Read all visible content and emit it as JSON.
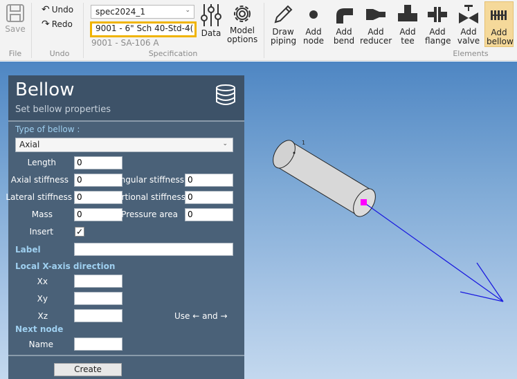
{
  "ribbon": {
    "file": {
      "save_label": "Save",
      "group_label": "File"
    },
    "undo": {
      "undo_label": "Undo",
      "redo_label": "Redo",
      "group_label": "Undo"
    },
    "specification": {
      "spec_value": "spec2024_1",
      "pipe_value": "9001 - 6\" Sch 40-Std-4(",
      "material_text": "9001 - SA-106 A",
      "data_label": "Data",
      "model_options_label": "Model options",
      "group_label": "Specification"
    },
    "elements": {
      "items": [
        {
          "label": "Draw piping",
          "icon": "pencil-icon"
        },
        {
          "label": "Add node",
          "icon": "dot-icon"
        },
        {
          "label": "Add bend",
          "icon": "bend-icon"
        },
        {
          "label": "Add reducer",
          "icon": "reducer-icon"
        },
        {
          "label": "Add tee",
          "icon": "tee-icon"
        },
        {
          "label": "Add flange",
          "icon": "flange-icon"
        },
        {
          "label": "Add valve",
          "icon": "valve-icon"
        },
        {
          "label": "Add bellow",
          "icon": "bellow-icon"
        }
      ],
      "group_label": "Elements"
    }
  },
  "panel": {
    "title": "Bellow",
    "subtitle": "Set bellow properties",
    "type_label": "Type of bellow :",
    "type_value": "Axial",
    "fields": {
      "length": {
        "label": "Length",
        "value": "0"
      },
      "axial_stiffness": {
        "label": "Axial stiffness",
        "value": "0"
      },
      "angular_stiffness": {
        "label": "Angular stiffness",
        "value": "0"
      },
      "lateral_stiffness": {
        "label": "Lateral stiffness",
        "value": "0"
      },
      "tortional_stiffness": {
        "label": "Tortional stiffness",
        "value": "0"
      },
      "mass": {
        "label": "Mass",
        "value": "0"
      },
      "pressure_area": {
        "label": "Pressure area",
        "value": "0"
      },
      "insert": {
        "label": "Insert",
        "checked": true
      }
    },
    "label_section": "Label",
    "local_x_section": "Local X-axis direction",
    "xx_label": "Xx",
    "xy_label": "Xy",
    "xz_label": "Xz",
    "hint_text": "Use ← and →",
    "next_node_section": "Next node",
    "name_label": "Name",
    "create_label": "Create"
  },
  "viewport": {
    "node_label": "1"
  },
  "colors": {
    "panel_bg": "#4a6178",
    "section_label": "#9fd0f0",
    "highlight_border": "#f0b400",
    "arrow": "#1a1adf",
    "node_marker": "#ff00ff",
    "active_button": "#f5d99a"
  }
}
